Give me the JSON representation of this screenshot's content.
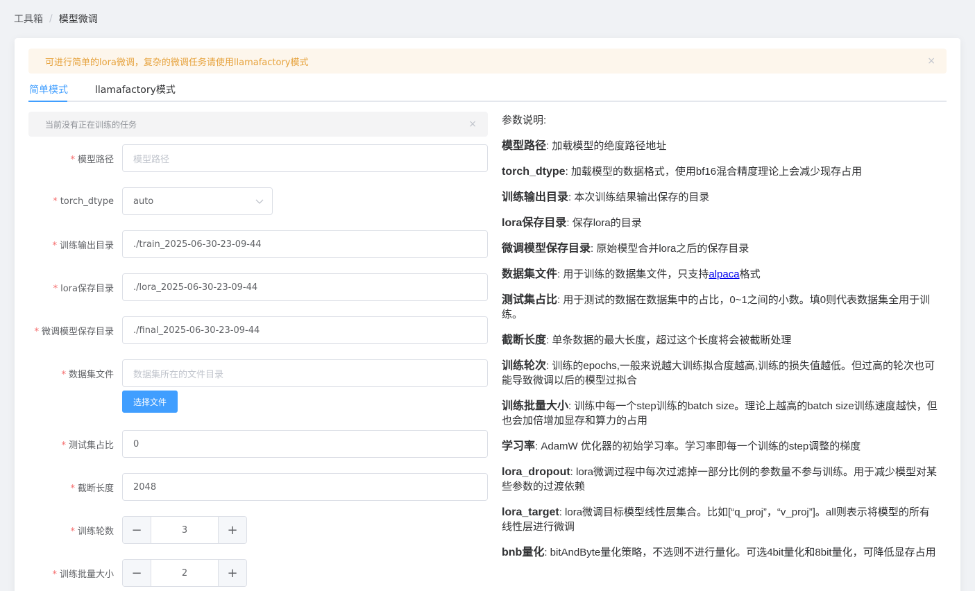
{
  "breadcrumb": {
    "root": "工具箱",
    "separator": "/",
    "current": "模型微调"
  },
  "alert_warning": {
    "text": "可进行简单的lora微调，复杂的微调任务请使用llamafactory模式",
    "close": "×"
  },
  "tabs": [
    {
      "label": "简单模式",
      "active": true
    },
    {
      "label": "llamafactory模式",
      "active": false
    }
  ],
  "alert_info": {
    "text": "当前没有正在训练的任务",
    "close": "×"
  },
  "form": {
    "required_mark": "*",
    "model_path": {
      "label": "模型路径",
      "value": "",
      "placeholder": "模型路径"
    },
    "torch_dtype": {
      "label": "torch_dtype",
      "value": "auto"
    },
    "output_dir": {
      "label": "训练输出目录",
      "value": "./train_2025-06-30-23-09-44"
    },
    "lora_dir": {
      "label": "lora保存目录",
      "value": "./lora_2025-06-30-23-09-44"
    },
    "final_dir": {
      "label": "微调模型保存目录",
      "value": "./final_2025-06-30-23-09-44"
    },
    "dataset": {
      "label": "数据集文件",
      "value": "",
      "placeholder": "数据集所在的文件目录",
      "button": "选择文件"
    },
    "test_ratio": {
      "label": "测试集占比",
      "value": "0"
    },
    "cutoff_len": {
      "label": "截断长度",
      "value": "2048"
    },
    "epochs": {
      "label": "训练轮数",
      "value": "3",
      "minus": "−",
      "plus": "+"
    },
    "batch_size": {
      "label": "训练批量大小",
      "value": "2",
      "minus": "−",
      "plus": "+"
    }
  },
  "help": {
    "title": "参数说明:",
    "items": [
      {
        "term": "模型路径",
        "desc": ": 加载模型的绝度路径地址"
      },
      {
        "term": "torch_dtype",
        "desc": ": 加载模型的数据格式，使用bf16混合精度理论上会减少现存占用"
      },
      {
        "term": "训练输出目录",
        "desc": ": 本次训练结果输出保存的目录"
      },
      {
        "term": "lora保存目录",
        "desc": ": 保存lora的目录"
      },
      {
        "term": "微调模型保存目录",
        "desc": ": 原始模型合并lora之后的保存目录"
      },
      {
        "term": "数据集文件",
        "desc": ": 用于训练的数据集文件，只支持",
        "link": "alpaca",
        "desc_after": "格式"
      },
      {
        "term": "测试集占比",
        "desc": ": 用于测试的数据在数据集中的占比，0~1之间的小数。填0则代表数据集全用于训练。"
      },
      {
        "term": "截断长度",
        "desc": ": 单条数据的最大长度，超过这个长度将会被截断处理"
      },
      {
        "term": "训练轮次",
        "desc": ": 训练的epochs,一般来说越大训练拟合度越高,训练的损失值越低。但过高的轮次也可能导致微调以后的模型过拟合"
      },
      {
        "term": "训练批量大小",
        "desc": ": 训练中每一个step训练的batch size。理论上越高的batch size训练速度越快，但也会加倍增加显存和算力的占用"
      },
      {
        "term": "学习率",
        "desc": ": AdamW 优化器的初始学习率。学习率即每一个训练的step调整的梯度"
      },
      {
        "term": "lora_dropout",
        "desc": ": lora微调过程中每次过滤掉一部分比例的参数量不参与训练。用于减少模型对某些参数的过渡依赖"
      },
      {
        "term": "lora_target",
        "desc": ": lora微调目标模型线性层集合。比如[“q_proj”，“v_proj”]。all则表示将模型的所有线性层进行微调"
      },
      {
        "term": "bnb量化",
        "desc": ": bitAndByte量化策略，不选则不进行量化。可选4bit量化和8bit量化，可降低显存占用"
      }
    ]
  }
}
